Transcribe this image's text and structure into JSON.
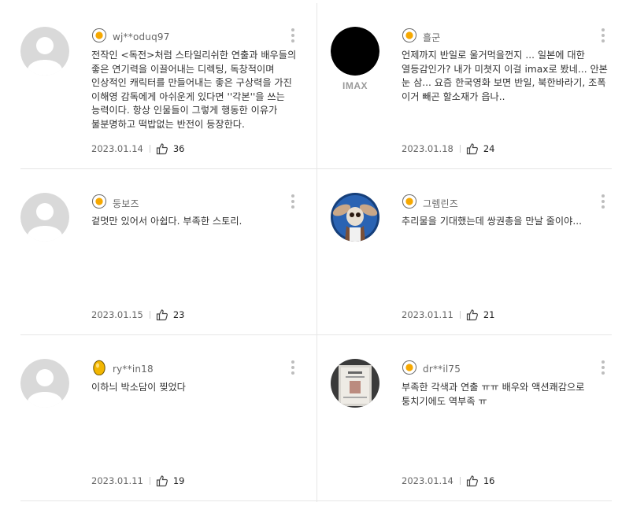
{
  "reviews": [
    {
      "nick": "wj**oduq97",
      "badge": "egg-fried",
      "avatar": "default",
      "text": "전작인 <독전>처럼 스타일리쉬한 연출과 배우들의 좋은 연기력을 이끌어내는 디렉팅, 독창적이며 인상적인 캐릭터를 만들어내는 좋은 구상력을 가진 이해영 감독에게 아쉬운게 있다면 ''각본''을 쓰는 능력이다. 항상 인물들이 그렇게 행동한 이유가 불분명하고 떡밥없는 반전이 등장한다.",
      "date": "2023.01.14",
      "likes": "36"
    },
    {
      "nick": "흘군",
      "badge": "egg-fried",
      "avatar": "imax",
      "avatar_text": "IMAX",
      "text": "언제까지 반일로 울거먹을껀지 ... 일본에 대한 열등감인가? 내가 미쳣지 이걸 imax로 봤네... 안본 눈 삼... 요즘 한국영화 보면 반일, 북한바라기, 조폭 이거 빼곤 할소재가 읍나..",
      "date": "2023.01.18",
      "likes": "24"
    },
    {
      "nick": "둥보즈",
      "badge": "egg-fried",
      "avatar": "default",
      "text": "겉멋만 있어서 아쉽다. 부족한 스토리.",
      "date": "2023.01.15",
      "likes": "23"
    },
    {
      "nick": "그렘린즈",
      "badge": "egg-fried",
      "avatar": "gremlin",
      "text": "추리물을 기대했는데 쌍권총을 만날 줄이야...",
      "date": "2023.01.11",
      "likes": "21"
    },
    {
      "nick": "ry**in18",
      "badge": "egg-gold",
      "avatar": "default",
      "text": "이하늬 박소담이 찢었다",
      "date": "2023.01.11",
      "likes": "19"
    },
    {
      "nick": "dr**il75",
      "badge": "egg-fried",
      "avatar": "photo",
      "text": "부족한 각색과 연출 ㅠㅠ 배우와 액션쾌감으로 퉁치기에도 역부족 ㅠ",
      "date": "2023.01.14",
      "likes": "16"
    }
  ]
}
